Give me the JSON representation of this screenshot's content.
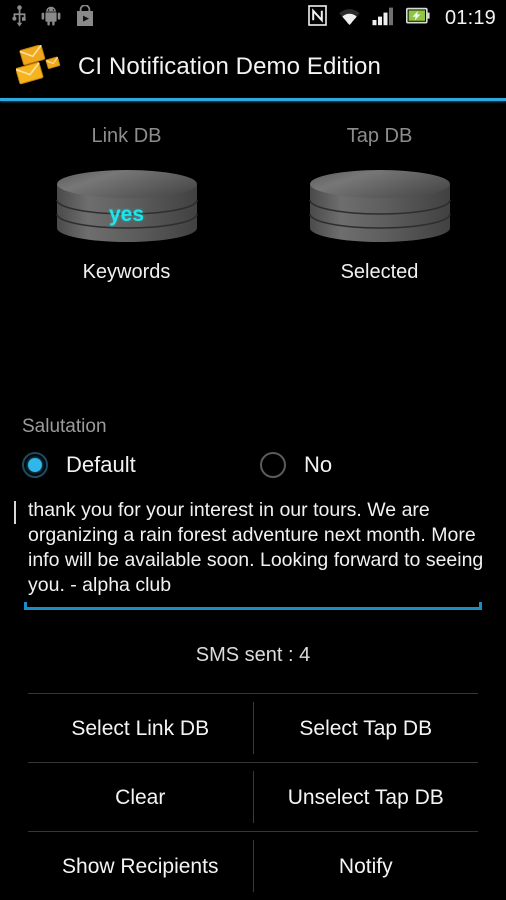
{
  "statusbar": {
    "icons_left": [
      "usb-icon",
      "android-robot-icon",
      "play-store-icon"
    ],
    "icons_right": [
      "nfc-icon",
      "wifi-icon",
      "signal-icon",
      "battery-charging-icon"
    ],
    "time": "01:19"
  },
  "actionbar": {
    "icon": "envelopes-icon",
    "title": "CI Notification Demo Edition",
    "accent_color": "#2fa8e0"
  },
  "databases": [
    {
      "top_label": "Link DB",
      "icon": "database-cylinder-icon",
      "value": "yes",
      "bottom_label": "Keywords"
    },
    {
      "top_label": "Tap DB",
      "icon": "database-cylinder-icon",
      "value": "",
      "bottom_label": "Selected"
    }
  ],
  "salutation": {
    "label": "Salutation",
    "options": [
      {
        "label": "Default",
        "selected": true
      },
      {
        "label": "No",
        "selected": false
      }
    ]
  },
  "message": {
    "value": "thank you for your interest in our tours. We are organizing a rain forest adventure next month. More info will be available soon. Looking forward to seeing you. - alpha club",
    "placeholder": "",
    "focused": true,
    "underline_color": "#1a8dc4"
  },
  "status": {
    "sms_sent": "SMS sent : 4"
  },
  "buttons": {
    "rows": [
      {
        "left": "Select Link DB",
        "right": "Select Tap DB"
      },
      {
        "left": "Clear",
        "right": "Unselect Tap DB"
      },
      {
        "left": "Show Recipients",
        "right": "Notify"
      }
    ]
  },
  "colors": {
    "accent": "#2fa8e0",
    "value_cyan": "#1ee6ec",
    "radio_blue": "#30b6e8",
    "background": "#000000"
  }
}
